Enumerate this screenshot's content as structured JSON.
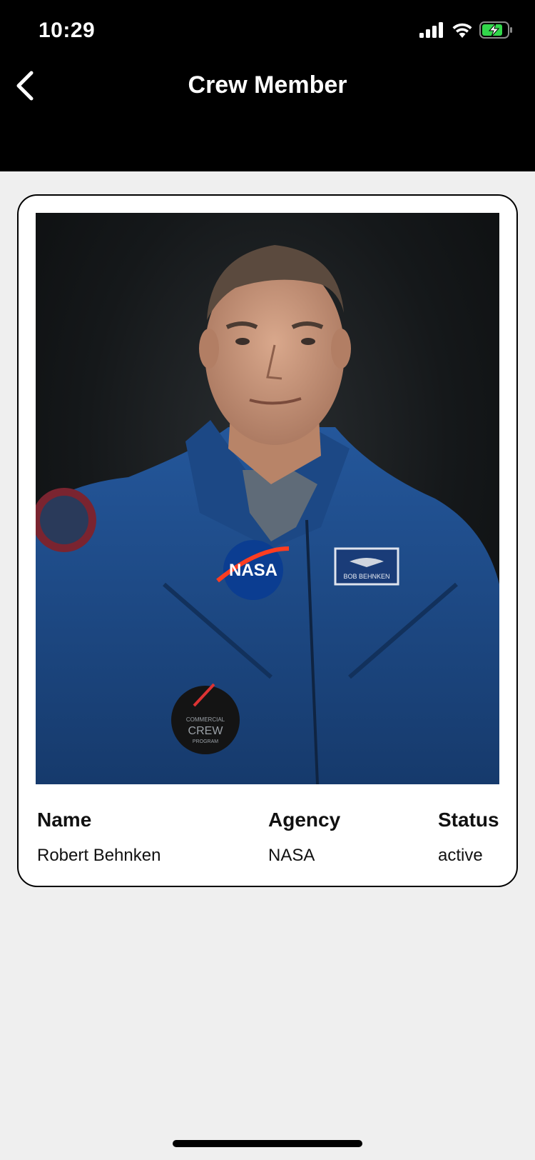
{
  "status_bar": {
    "time": "10:29",
    "icons": [
      "signal-icon",
      "wifi-icon",
      "battery-charging-icon"
    ],
    "battery_color": "#32d74b"
  },
  "nav": {
    "title": "Crew Member",
    "back_icon": "chevron-left-icon"
  },
  "crew": {
    "photo_alt": "Robert Behnken",
    "patch_texts": {
      "nasa": "NASA",
      "name_tag": "BOB BEHNKEN",
      "commercial": "COMMERCIAL",
      "crew": "CREW",
      "program": "PROGRAM"
    },
    "fields": {
      "name_label": "Name",
      "name_value": "Robert Behnken",
      "agency_label": "Agency",
      "agency_value": "NASA",
      "status_label": "Status",
      "status_value": "active"
    }
  },
  "colors": {
    "header_bg": "#000000",
    "page_bg": "#efefef",
    "card_bg": "#ffffff",
    "flight_suit": "#1d4a86"
  }
}
